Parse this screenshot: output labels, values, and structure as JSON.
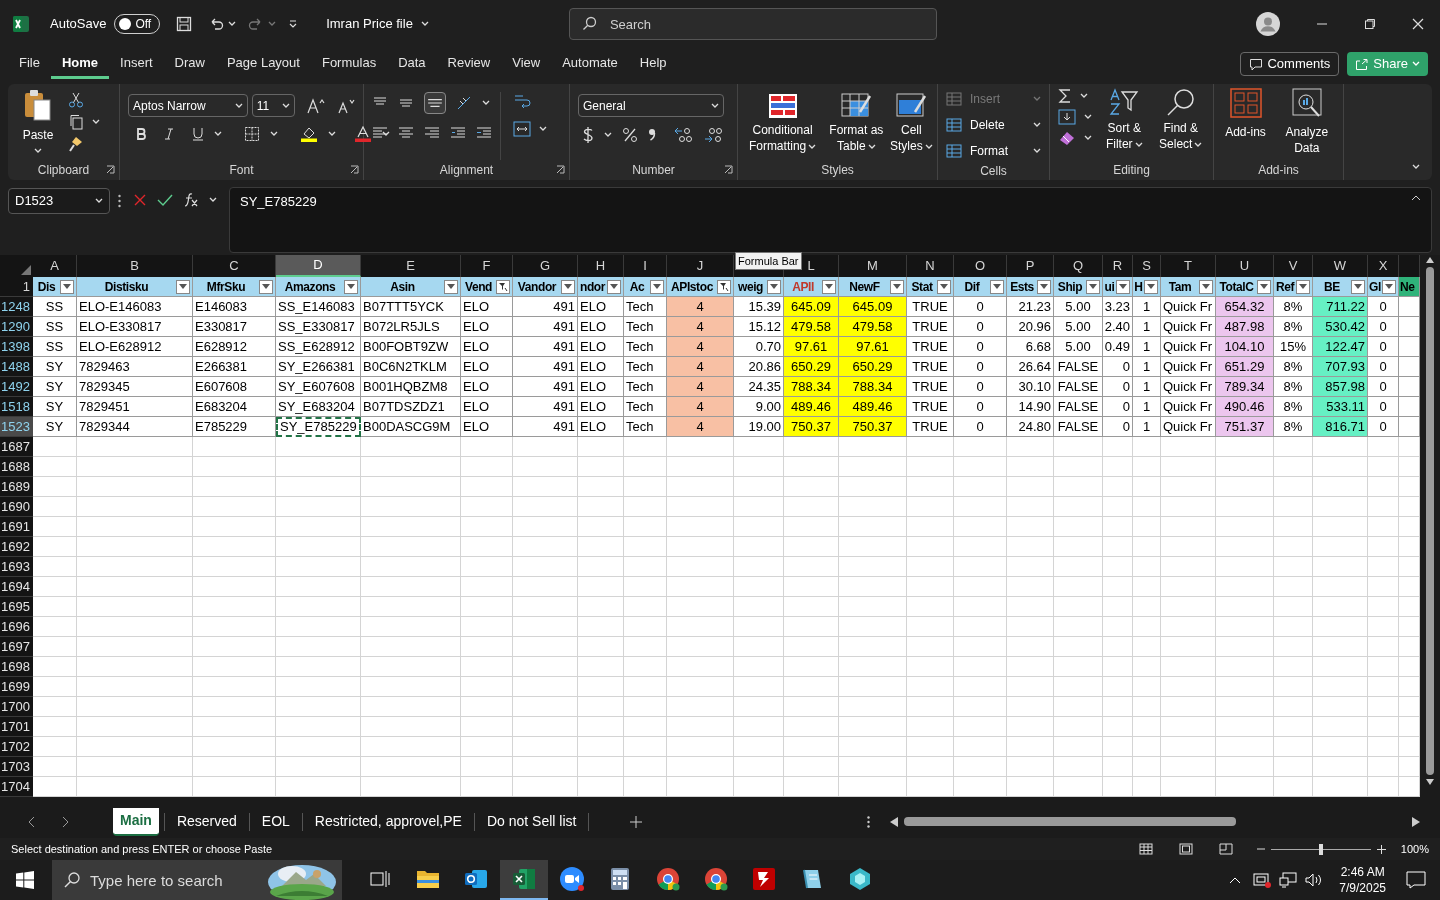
{
  "title_bar": {
    "autosave": "AutoSave",
    "autosave_toggle": {
      "label": "Off",
      "on": false
    },
    "file_name": "Imran Price file",
    "search": {
      "placeholder": "Search"
    }
  },
  "menu_tabs": [
    {
      "label": "File",
      "selected": false
    },
    {
      "label": "Home",
      "selected": true
    },
    {
      "label": "Insert",
      "selected": false
    },
    {
      "label": "Draw",
      "selected": false
    },
    {
      "label": "Page Layout",
      "selected": false
    },
    {
      "label": "Formulas",
      "selected": false
    },
    {
      "label": "Data",
      "selected": false
    },
    {
      "label": "Review",
      "selected": false
    },
    {
      "label": "View",
      "selected": false
    },
    {
      "label": "Automate",
      "selected": false
    },
    {
      "label": "Help",
      "selected": false
    }
  ],
  "menu_buttons": {
    "comments": "Comments",
    "share": "Share"
  },
  "ribbon": {
    "clipboard": {
      "label": "Clipboard",
      "paste": "Paste"
    },
    "font": {
      "label": "Font",
      "font_name": "Aptos Narrow",
      "font_size": "11"
    },
    "alignment": {
      "label": "Alignment"
    },
    "number": {
      "label": "Number",
      "format": "General"
    },
    "styles": {
      "label": "Styles",
      "buttons": [
        "Conditional Formatting",
        "Format as Table",
        "Cell Styles"
      ]
    },
    "cells": {
      "label": "Cells",
      "buttons": [
        {
          "label": "Insert",
          "disabled": true
        },
        {
          "label": "Delete",
          "disabled": false
        },
        {
          "label": "Format",
          "disabled": false
        }
      ]
    },
    "editing": {
      "label": "Editing",
      "buttons": [
        "Sort & Filter",
        "Find & Select"
      ]
    },
    "addins": {
      "label": "Add-ins",
      "buttons": [
        "Add-ins",
        "Analyze Data"
      ]
    }
  },
  "formula_bar": {
    "name_box": "D1523",
    "formula": "SY_E785229",
    "tooltip": "Formula Bar"
  },
  "sheet": {
    "columns": [
      {
        "letter": "A",
        "header": {
          "label": "Dis",
          "color": "#a6d8f0",
          "highlighted": false
        },
        "color": "#ffffff",
        "filtered": false,
        "selected": false
      },
      {
        "letter": "B",
        "header": {
          "label": "Distisku",
          "color": "#a6d8f0",
          "highlighted": false
        },
        "color": "#ffffff",
        "filtered": false,
        "selected": false
      },
      {
        "letter": "C",
        "header": {
          "label": "MfrSku",
          "color": "#a6d8f0",
          "highlighted": false
        },
        "color": "#ffffff",
        "filtered": false,
        "selected": false
      },
      {
        "letter": "D",
        "header": {
          "label": "Amazons",
          "color": "#a6d8f0",
          "highlighted": false
        },
        "color": "#ffffff",
        "filtered": false,
        "selected": true
      },
      {
        "letter": "E",
        "header": {
          "label": "Asin",
          "color": "#a6d8f0",
          "highlighted": false
        },
        "color": "#ffffff",
        "filtered": false,
        "selected": false
      },
      {
        "letter": "F",
        "header": {
          "label": "Vend",
          "color": "#a6d8f0",
          "highlighted": false
        },
        "color": "#ffffff",
        "filtered": true,
        "selected": false
      },
      {
        "letter": "G",
        "header": {
          "label": "Vandor",
          "color": "#a6d8f0",
          "highlighted": false
        },
        "color": "#ffffff",
        "filtered": false,
        "selected": false
      },
      {
        "letter": "H",
        "header": {
          "label": "ndor",
          "color": "#a6d8f0",
          "highlighted": false
        },
        "color": "#ffffff",
        "filtered": false,
        "selected": false
      },
      {
        "letter": "I",
        "header": {
          "label": "Ac",
          "color": "#a6d8f0",
          "highlighted": false
        },
        "color": "#ffffff",
        "filtered": false,
        "selected": false
      },
      {
        "letter": "J",
        "header": {
          "label": "APIstoc",
          "color": "#a6d8f0",
          "highlighted": false
        },
        "color": "#f8c0a4",
        "filtered": true,
        "selected": false
      },
      {
        "header": {
          "label": "weig",
          "color": "#a6d8f0",
          "highlighted": false
        },
        "color": "#ffffff",
        "filtered": false,
        "selected": false
      },
      {
        "letter": "L",
        "header": {
          "label": "APII",
          "color": "#a6d8f0",
          "highlighted": true
        },
        "color": "#ffff00",
        "filtered": false,
        "selected": false
      },
      {
        "letter": "M",
        "header": {
          "label": "NewF",
          "color": "#a6d8f0",
          "highlighted": false
        },
        "color": "#ffff00",
        "filtered": false,
        "selected": false
      },
      {
        "letter": "N",
        "header": {
          "label": "Stat",
          "color": "#a6d8f0",
          "highlighted": false
        },
        "color": "#ffffff",
        "filtered": false,
        "selected": false
      },
      {
        "letter": "O",
        "header": {
          "label": "Dif",
          "color": "#a6d8f0",
          "highlighted": false
        },
        "color": "#ffffff",
        "filtered": false,
        "selected": false
      },
      {
        "letter": "P",
        "header": {
          "label": "Ests",
          "color": "#a6d8f0",
          "highlighted": false
        },
        "color": "#ffffff",
        "filtered": false,
        "selected": false
      },
      {
        "letter": "Q",
        "header": {
          "label": "Ship",
          "color": "#a6d8f0",
          "highlighted": false
        },
        "color": "#ffffff",
        "filtered": false,
        "selected": false
      },
      {
        "letter": "R",
        "header": {
          "label": "ui",
          "color": "#a6d8f0",
          "highlighted": false
        },
        "color": "#ffffff",
        "filtered": false,
        "selected": false
      },
      {
        "letter": "S",
        "header": {
          "label": "H",
          "color": "#a6d8f0",
          "highlighted": false
        },
        "color": "#ffffff",
        "filtered": false,
        "selected": false
      },
      {
        "letter": "T",
        "header": {
          "label": "Tam",
          "color": "#a6d8f0",
          "highlighted": false
        },
        "color": "#ffffff",
        "filtered": false,
        "selected": false
      },
      {
        "letter": "U",
        "header": {
          "label": "TotalC",
          "color": "#a6d8f0",
          "highlighted": false
        },
        "color": "#ecc6ee",
        "filtered": false,
        "selected": false
      },
      {
        "letter": "V",
        "header": {
          "label": "Ref",
          "color": "#a6d8f0",
          "highlighted": false
        },
        "color": "#ffffff",
        "filtered": false,
        "selected": false
      },
      {
        "letter": "W",
        "header": {
          "label": "BE",
          "color": "#a6d8f0",
          "highlighted": false
        },
        "color": "#66f0c4",
        "filtered": false,
        "selected": false
      },
      {
        "letter": "X",
        "header": {
          "label": "Gl",
          "color": "#a6d8f0",
          "highlighted": false
        },
        "color": "#ffffff",
        "filtered": false,
        "selected": false
      },
      {
        "header": {
          "label": "Ne",
          "color": "#2fb37a",
          "highlighted": false
        },
        "color": "#ffffff",
        "filtered": false,
        "selected": false
      }
    ],
    "header_row": "1",
    "rows": [
      {
        "number": "1248",
        "selected": false,
        "cells": [
          "SS",
          "ELO-E146083",
          "E146083",
          "SS_E146083",
          "B07TTT5YCK",
          "ELO",
          "491",
          "ELO",
          "Tech",
          "4",
          "15.39",
          "645.09",
          "645.09",
          "TRUE",
          "0",
          "21.23",
          "5.00",
          "3.23",
          "1",
          "Quick Fr",
          "654.32",
          "8%",
          "711.22",
          "0"
        ]
      },
      {
        "number": "1290",
        "selected": false,
        "cells": [
          "SS",
          "ELO-E330817",
          "E330817",
          "SS_E330817",
          "B072LR5JLS",
          "ELO",
          "491",
          "ELO",
          "Tech",
          "4",
          "15.12",
          "479.58",
          "479.58",
          "TRUE",
          "0",
          "20.96",
          "5.00",
          "2.40",
          "1",
          "Quick Fr",
          "487.98",
          "8%",
          "530.42",
          "0"
        ]
      },
      {
        "number": "1398",
        "selected": false,
        "cells": [
          "SS",
          "ELO-E628912",
          "E628912",
          "SS_E628912",
          "B00FOBT9ZW",
          "ELO",
          "491",
          "ELO",
          "Tech",
          "4",
          "0.70",
          "97.61",
          "97.61",
          "TRUE",
          "0",
          "6.68",
          "5.00",
          "0.49",
          "1",
          "Quick Fr",
          "104.10",
          "15%",
          "122.47",
          "0"
        ]
      },
      {
        "number": "1488",
        "selected": false,
        "cells": [
          "SY",
          "7829463",
          "E266381",
          "SY_E266381",
          "B0C6N2TKLM",
          "ELO",
          "491",
          "ELO",
          "Tech",
          "4",
          "20.86",
          "650.29",
          "650.29",
          "TRUE",
          "0",
          "26.64",
          "FALSE",
          "0",
          "1",
          "Quick Fr",
          "651.29",
          "8%",
          "707.93",
          "0"
        ]
      },
      {
        "number": "1492",
        "selected": false,
        "cells": [
          "SY",
          "7829345",
          "E607608",
          "SY_E607608",
          "B001HQBZM8",
          "ELO",
          "491",
          "ELO",
          "Tech",
          "4",
          "24.35",
          "788.34",
          "788.34",
          "TRUE",
          "0",
          "30.10",
          "FALSE",
          "0",
          "1",
          "Quick Fr",
          "789.34",
          "8%",
          "857.98",
          "0"
        ]
      },
      {
        "number": "1518",
        "selected": false,
        "cells": [
          "SY",
          "7829451",
          "E683204",
          "SY_E683204",
          "B07TDSZDZ1",
          "ELO",
          "491",
          "ELO",
          "Tech",
          "4",
          "9.00",
          "489.46",
          "489.46",
          "TRUE",
          "0",
          "14.90",
          "FALSE",
          "0",
          "1",
          "Quick Fr",
          "490.46",
          "8%",
          "533.11",
          "0"
        ]
      },
      {
        "number": "1523",
        "selected": true,
        "cells": [
          "SY",
          "7829344",
          "E785229",
          "SY_E785229",
          "B00DASCG9M",
          "ELO",
          "491",
          "ELO",
          "Tech",
          "4",
          "19.00",
          "750.37",
          "750.37",
          "TRUE",
          "0",
          "24.80",
          "FALSE",
          "0",
          "1",
          "Quick Fr",
          "751.37",
          "8%",
          "816.71",
          "0"
        ]
      }
    ],
    "empty_rows": [
      "1687",
      "1688",
      "1689",
      "1690",
      "1691",
      "1692",
      "1693",
      "1694",
      "1695",
      "1696",
      "1697",
      "1698",
      "1699",
      "1700",
      "1701",
      "1702",
      "1703",
      "1704"
    ]
  },
  "sheet_tabs": [
    {
      "label": "Main",
      "selected": true
    },
    {
      "label": "Reserved",
      "selected": false
    },
    {
      "label": "EOL",
      "selected": false
    },
    {
      "label": "Restricted, approvel,PE",
      "selected": false
    },
    {
      "label": "Do not Sell list",
      "selected": false
    }
  ],
  "status_bar": {
    "message": "Select destination and press ENTER or choose Paste",
    "zoom": "100%",
    "zoom_slider": {
      "level": 0.5
    }
  },
  "taskbar": {
    "search": {
      "placeholder": "Type here to search"
    },
    "apps": [
      {
        "kind": "taskview",
        "active": false
      },
      {
        "kind": "folder",
        "active": false
      },
      {
        "kind": "outlook",
        "active": false
      },
      {
        "kind": "excel",
        "active": true
      },
      {
        "kind": "zoom",
        "active": false
      },
      {
        "kind": "calculator",
        "active": false
      },
      {
        "kind": "chrome",
        "active": false
      },
      {
        "kind": "chrome",
        "active": false
      },
      {
        "kind": "filezilla",
        "active": false
      },
      {
        "kind": "notes",
        "active": false
      },
      {
        "kind": "cube",
        "active": false
      }
    ],
    "time": "2:46 AM",
    "date": "7/9/2025"
  }
}
